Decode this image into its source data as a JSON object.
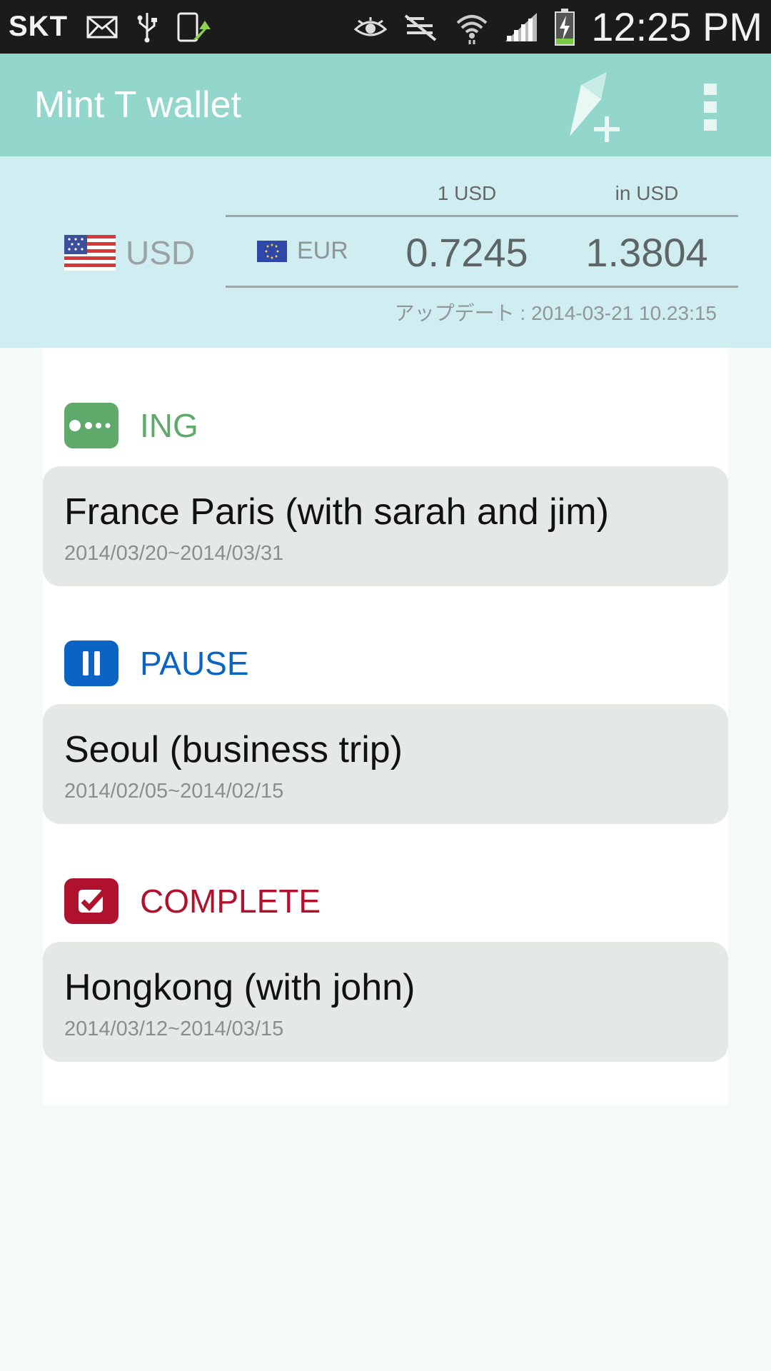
{
  "status_bar": {
    "carrier": "SKT",
    "time": "12:25 PM"
  },
  "app_bar": {
    "title": "Mint T wallet",
    "add_trip_icon": "add-trip-icon",
    "overflow_icon": "overflow-menu-icon"
  },
  "currency": {
    "base": "USD",
    "target": "EUR",
    "col_per_base": "1 USD",
    "col_in_base": "in USD",
    "rate_per_base": "0.7245",
    "rate_in_base": "1.3804",
    "updated": "アップデート : 2014-03-21 10.23:15"
  },
  "groups": [
    {
      "label": "ING",
      "color": "#5fa96b",
      "icon": "in-progress-icon",
      "trip": {
        "name": "France Paris (with sarah and jim)",
        "dates": "2014/03/20~2014/03/31"
      }
    },
    {
      "label": "PAUSE",
      "color": "#0a64c4",
      "icon": "pause-icon",
      "trip": {
        "name": "Seoul (business trip)",
        "dates": "2014/02/05~2014/02/15"
      }
    },
    {
      "label": "COMPLETE",
      "color": "#b0122e",
      "icon": "check-icon",
      "trip": {
        "name": "Hongkong (with john)",
        "dates": "2014/03/12~2014/03/15"
      }
    }
  ]
}
